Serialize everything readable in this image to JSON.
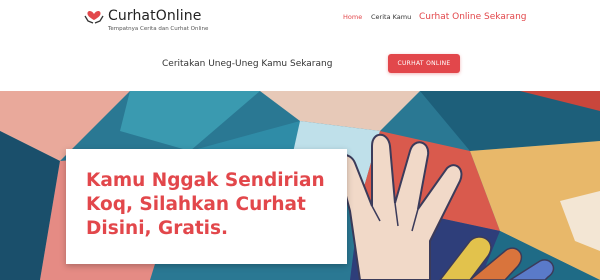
{
  "header": {
    "brand": "CurhatOnline",
    "tagline": "Tempatnya Cerita dan Curhat Online",
    "logo_icon": "heart-hands-icon",
    "nav": {
      "home": "Home",
      "cerita": "Cerita Kamu",
      "curhat": "Curhat Online Sekarang"
    }
  },
  "banner": {
    "text": "Ceritakan Uneg-Uneg Kamu Sekarang",
    "button": "CURHAT ONLINE"
  },
  "hero": {
    "title": "Kamu Nggak Sendirian Koq, Silahkan Curhat Disini, Gratis."
  },
  "colors": {
    "accent": "#e2474b",
    "hero_blue": "#1f6b86"
  }
}
